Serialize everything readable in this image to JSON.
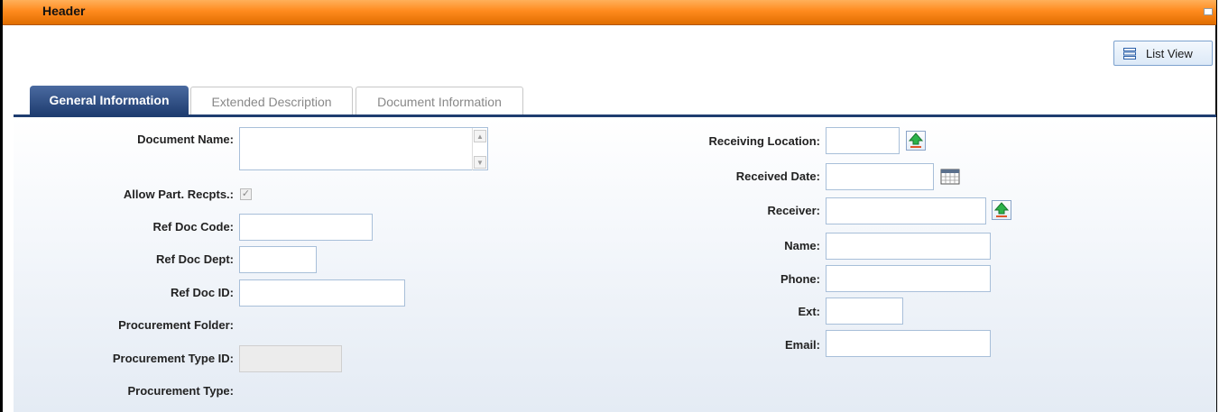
{
  "header": {
    "title": "Header"
  },
  "toolbar": {
    "list_view_label": "List View"
  },
  "tabs": [
    {
      "label": "General Information",
      "active": true
    },
    {
      "label": "Extended Description",
      "active": false
    },
    {
      "label": "Document Information",
      "active": false
    }
  ],
  "form": {
    "left": {
      "document_name": {
        "label": "Document Name:",
        "value": ""
      },
      "allow_part_recpts": {
        "label": "Allow Part. Recpts.:",
        "checked": true,
        "disabled": true
      },
      "ref_doc_code": {
        "label": "Ref Doc Code:",
        "value": ""
      },
      "ref_doc_dept": {
        "label": "Ref Doc Dept:",
        "value": ""
      },
      "ref_doc_id": {
        "label": "Ref Doc ID:",
        "value": ""
      },
      "procurement_folder": {
        "label": "Procurement Folder:"
      },
      "procurement_type_id": {
        "label": "Procurement Type ID:",
        "value": "",
        "disabled": true
      },
      "procurement_type": {
        "label": "Procurement Type:"
      }
    },
    "right": {
      "receiving_location": {
        "label": "Receiving Location:",
        "value": ""
      },
      "received_date": {
        "label": "Received Date:",
        "value": ""
      },
      "receiver": {
        "label": "Receiver:",
        "value": ""
      },
      "name": {
        "label": "Name:",
        "value": ""
      },
      "phone": {
        "label": "Phone:",
        "value": ""
      },
      "ext": {
        "label": "Ext:",
        "value": ""
      },
      "email": {
        "label": "Email:",
        "value": ""
      }
    }
  },
  "icons": {
    "list_view": "list-icon",
    "collapse": "minimize-icon",
    "picker": "upload-arrow-icon",
    "calendar": "calendar-icon"
  },
  "colors": {
    "header_bar": "#ff8a1e",
    "active_tab": "#1f3d70",
    "input_border": "#a8bfd9"
  }
}
